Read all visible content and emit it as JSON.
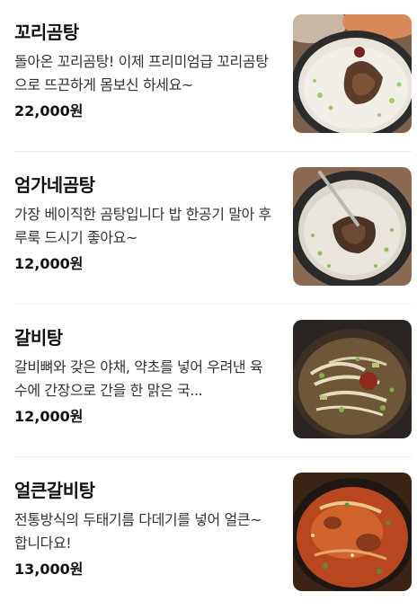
{
  "menu": {
    "items": [
      {
        "name": "꼬리곰탕",
        "description": "돌아온 꼬리곰탕! 이제 프리미엄급 꼬리곰탕으로 뜨끈하게 몸보신 하세요~",
        "price": "22,000원",
        "image_icon": "oxtail-soup-photo"
      },
      {
        "name": "엄가네곰탕",
        "description": "가장 베이직한 곰탕입니다 밥 한공기 말아 후루룩 드시기 좋아요~",
        "price": "12,000원",
        "image_icon": "gomtang-photo"
      },
      {
        "name": "갈비탕",
        "description": "갈비뼈와 갖은 야채, 약초를 넣어 우려낸 육수에 간장으로 간을 한 맑은 국...",
        "price": "12,000원",
        "image_icon": "galbitang-photo"
      },
      {
        "name": "얼큰갈비탕",
        "description": "전통방식의 두태기름 다데기를 넣어 얼큰~ 합니다요!",
        "price": "13,000원",
        "image_icon": "spicy-galbitang-photo"
      }
    ]
  }
}
